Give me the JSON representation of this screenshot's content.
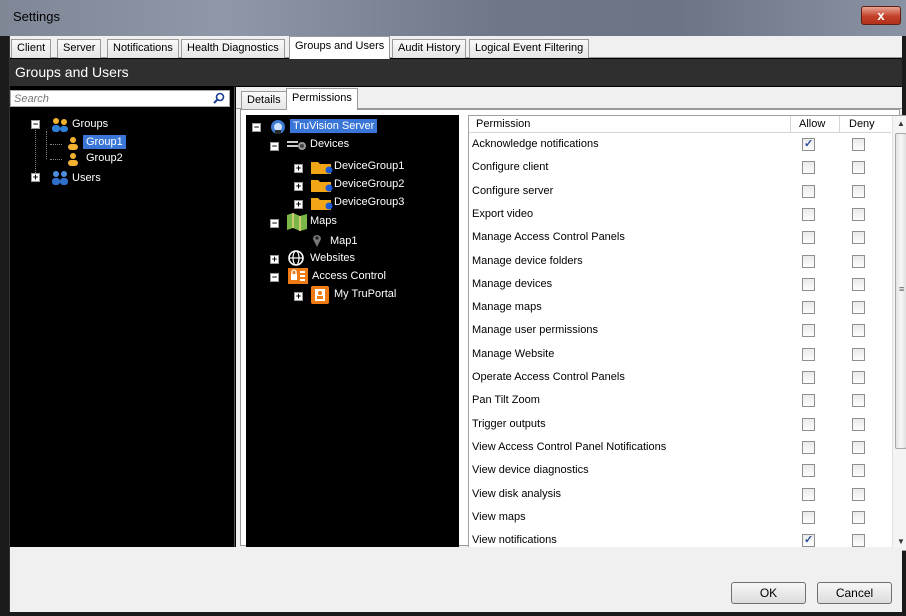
{
  "window": {
    "title": "Settings",
    "close_glyph": "x"
  },
  "tabs": [
    {
      "label": "Client"
    },
    {
      "label": "Server"
    },
    {
      "label": "Notifications"
    },
    {
      "label": "Health Diagnostics"
    },
    {
      "label": "Groups and Users",
      "active": true
    },
    {
      "label": "Audit History"
    },
    {
      "label": "Logical Event Filtering"
    }
  ],
  "section_title": "Groups and Users",
  "search": {
    "placeholder": "Search",
    "icon": "search-icon"
  },
  "groups_tree": {
    "groups_label": "Groups",
    "group1": "Group1",
    "group2": "Group2",
    "users_label": "Users",
    "expand_glyph": "+",
    "collapse_glyph": "−"
  },
  "subtabs": [
    {
      "label": "Details"
    },
    {
      "label": "Permissions",
      "active": true
    }
  ],
  "resource_tree": {
    "server": "TruVision Server",
    "devices": "Devices",
    "device_groups": [
      "DeviceGroup1",
      "DeviceGroup2",
      "DeviceGroup3"
    ],
    "maps": "Maps",
    "map1": "Map1",
    "websites": "Websites",
    "access_control": "Access Control",
    "my_truportal": "My TruPortal"
  },
  "grid": {
    "headers": {
      "permission": "Permission",
      "allow": "Allow",
      "deny": "Deny"
    },
    "rows": [
      {
        "label": "Acknowledge notifications",
        "allow": true,
        "deny": false
      },
      {
        "label": "Configure client",
        "allow": false,
        "deny": false
      },
      {
        "label": "Configure server",
        "allow": false,
        "deny": false
      },
      {
        "label": "Export video",
        "allow": false,
        "deny": false
      },
      {
        "label": "Manage Access Control Panels",
        "allow": false,
        "deny": false
      },
      {
        "label": "Manage device folders",
        "allow": false,
        "deny": false
      },
      {
        "label": "Manage devices",
        "allow": false,
        "deny": false
      },
      {
        "label": "Manage maps",
        "allow": false,
        "deny": false
      },
      {
        "label": "Manage user permissions",
        "allow": false,
        "deny": false
      },
      {
        "label": "Manage Website",
        "allow": false,
        "deny": false
      },
      {
        "label": "Operate Access Control Panels",
        "allow": false,
        "deny": false
      },
      {
        "label": "Pan Tilt Zoom",
        "allow": false,
        "deny": false
      },
      {
        "label": "Trigger outputs",
        "allow": false,
        "deny": false
      },
      {
        "label": "View Access Control Panel Notifications",
        "allow": false,
        "deny": false
      },
      {
        "label": "View device diagnostics",
        "allow": false,
        "deny": false
      },
      {
        "label": "View disk analysis",
        "allow": false,
        "deny": false
      },
      {
        "label": "View maps",
        "allow": false,
        "deny": false
      },
      {
        "label": "View notifications",
        "allow": true,
        "deny": false
      }
    ],
    "scroll_up_glyph": "▲",
    "scroll_down_glyph": "▼",
    "scroll_grip_glyph": "≡"
  },
  "buttons": {
    "ok": "OK",
    "cancel": "Cancel"
  },
  "colors": {
    "selection": "#3a76d8",
    "folder": "#f2a516",
    "access_control": "#f07a14"
  }
}
